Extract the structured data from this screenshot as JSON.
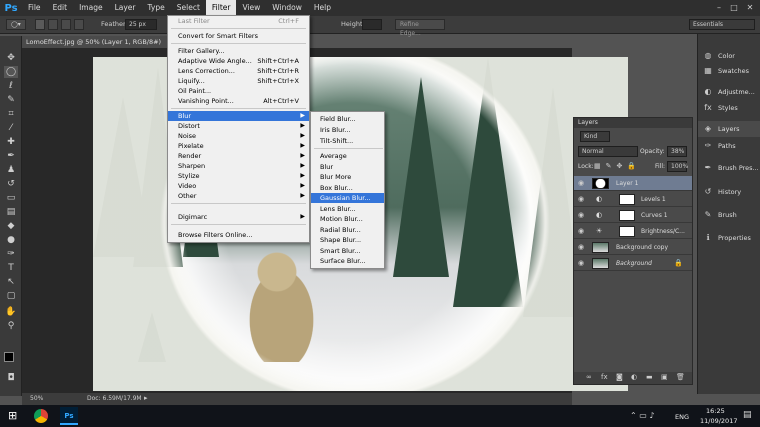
{
  "menubar": {
    "logo": "Ps",
    "items": [
      "File",
      "Edit",
      "Image",
      "Layer",
      "Type",
      "Select",
      "Filter",
      "View",
      "Window",
      "Help"
    ],
    "active": "Filter"
  },
  "options": {
    "feather_label": "Feather:",
    "feather_value": "25 px",
    "height_label": "Height:",
    "refine_edge": "Refine Edge...",
    "workspace": "Essentials"
  },
  "document": {
    "tab_title": "LomoEffect.jpg @ 50% (Layer 1, RGB/8#)",
    "zoom": "50%",
    "doc_size": "Doc: 6.59M/17.9M"
  },
  "filter_menu": {
    "items": [
      {
        "label": "Last Filter",
        "shortcut": "Ctrl+F",
        "disabled": true
      },
      {
        "label": "Convert for Smart Filters",
        "shortcut": ""
      },
      {
        "label": "Filter Gallery...",
        "shortcut": ""
      },
      {
        "label": "Adaptive Wide Angle...",
        "shortcut": "Shift+Ctrl+A"
      },
      {
        "label": "Lens Correction...",
        "shortcut": "Shift+Ctrl+R"
      },
      {
        "label": "Liquify...",
        "shortcut": "Shift+Ctrl+X"
      },
      {
        "label": "Oil Paint...",
        "shortcut": ""
      },
      {
        "label": "Vanishing Point...",
        "shortcut": "Alt+Ctrl+V"
      },
      {
        "label": "Blur",
        "submenu": true
      },
      {
        "label": "Distort",
        "submenu": true
      },
      {
        "label": "Noise",
        "submenu": true
      },
      {
        "label": "Pixelate",
        "submenu": true
      },
      {
        "label": "Render",
        "submenu": true
      },
      {
        "label": "Sharpen",
        "submenu": true
      },
      {
        "label": "Stylize",
        "submenu": true
      },
      {
        "label": "Video",
        "submenu": true
      },
      {
        "label": "Other",
        "submenu": true
      },
      {
        "label": "Digimarc",
        "submenu": true
      },
      {
        "label": "Browse Filters Online...",
        "shortcut": ""
      }
    ]
  },
  "blur_menu": {
    "items": [
      "Field Blur...",
      "Iris Blur...",
      "Tilt-Shift...",
      "Average",
      "Blur",
      "Blur More",
      "Box Blur...",
      "Gaussian Blur...",
      "Lens Blur...",
      "Motion Blur...",
      "Radial Blur...",
      "Shape Blur...",
      "Smart Blur...",
      "Surface Blur..."
    ],
    "highlighted": "Gaussian Blur..."
  },
  "layers_panel": {
    "tab": "Layers",
    "kind": "Kind",
    "blend_mode": "Normal",
    "opacity_label": "Opacity:",
    "opacity": "38%",
    "lock_label": "Lock:",
    "fill_label": "Fill:",
    "fill": "100%",
    "layers": [
      {
        "name": "Layer 1",
        "selected": true
      },
      {
        "name": "Levels 1"
      },
      {
        "name": "Curves 1"
      },
      {
        "name": "Brightness/C..."
      },
      {
        "name": "Background copy"
      },
      {
        "name": "Background",
        "locked": true
      }
    ]
  },
  "dock": {
    "items": [
      "Color",
      "Swatches",
      "Adjustme...",
      "Styles",
      "Layers",
      "Paths",
      "Brush Pres...",
      "History",
      "Brush",
      "Properties"
    ]
  },
  "taskbar": {
    "time": "16:25",
    "date": "11/09/2017",
    "lang": "ENG"
  },
  "colors": {
    "highlight": "#3475d9",
    "ps_blue": "#31a8ff"
  }
}
